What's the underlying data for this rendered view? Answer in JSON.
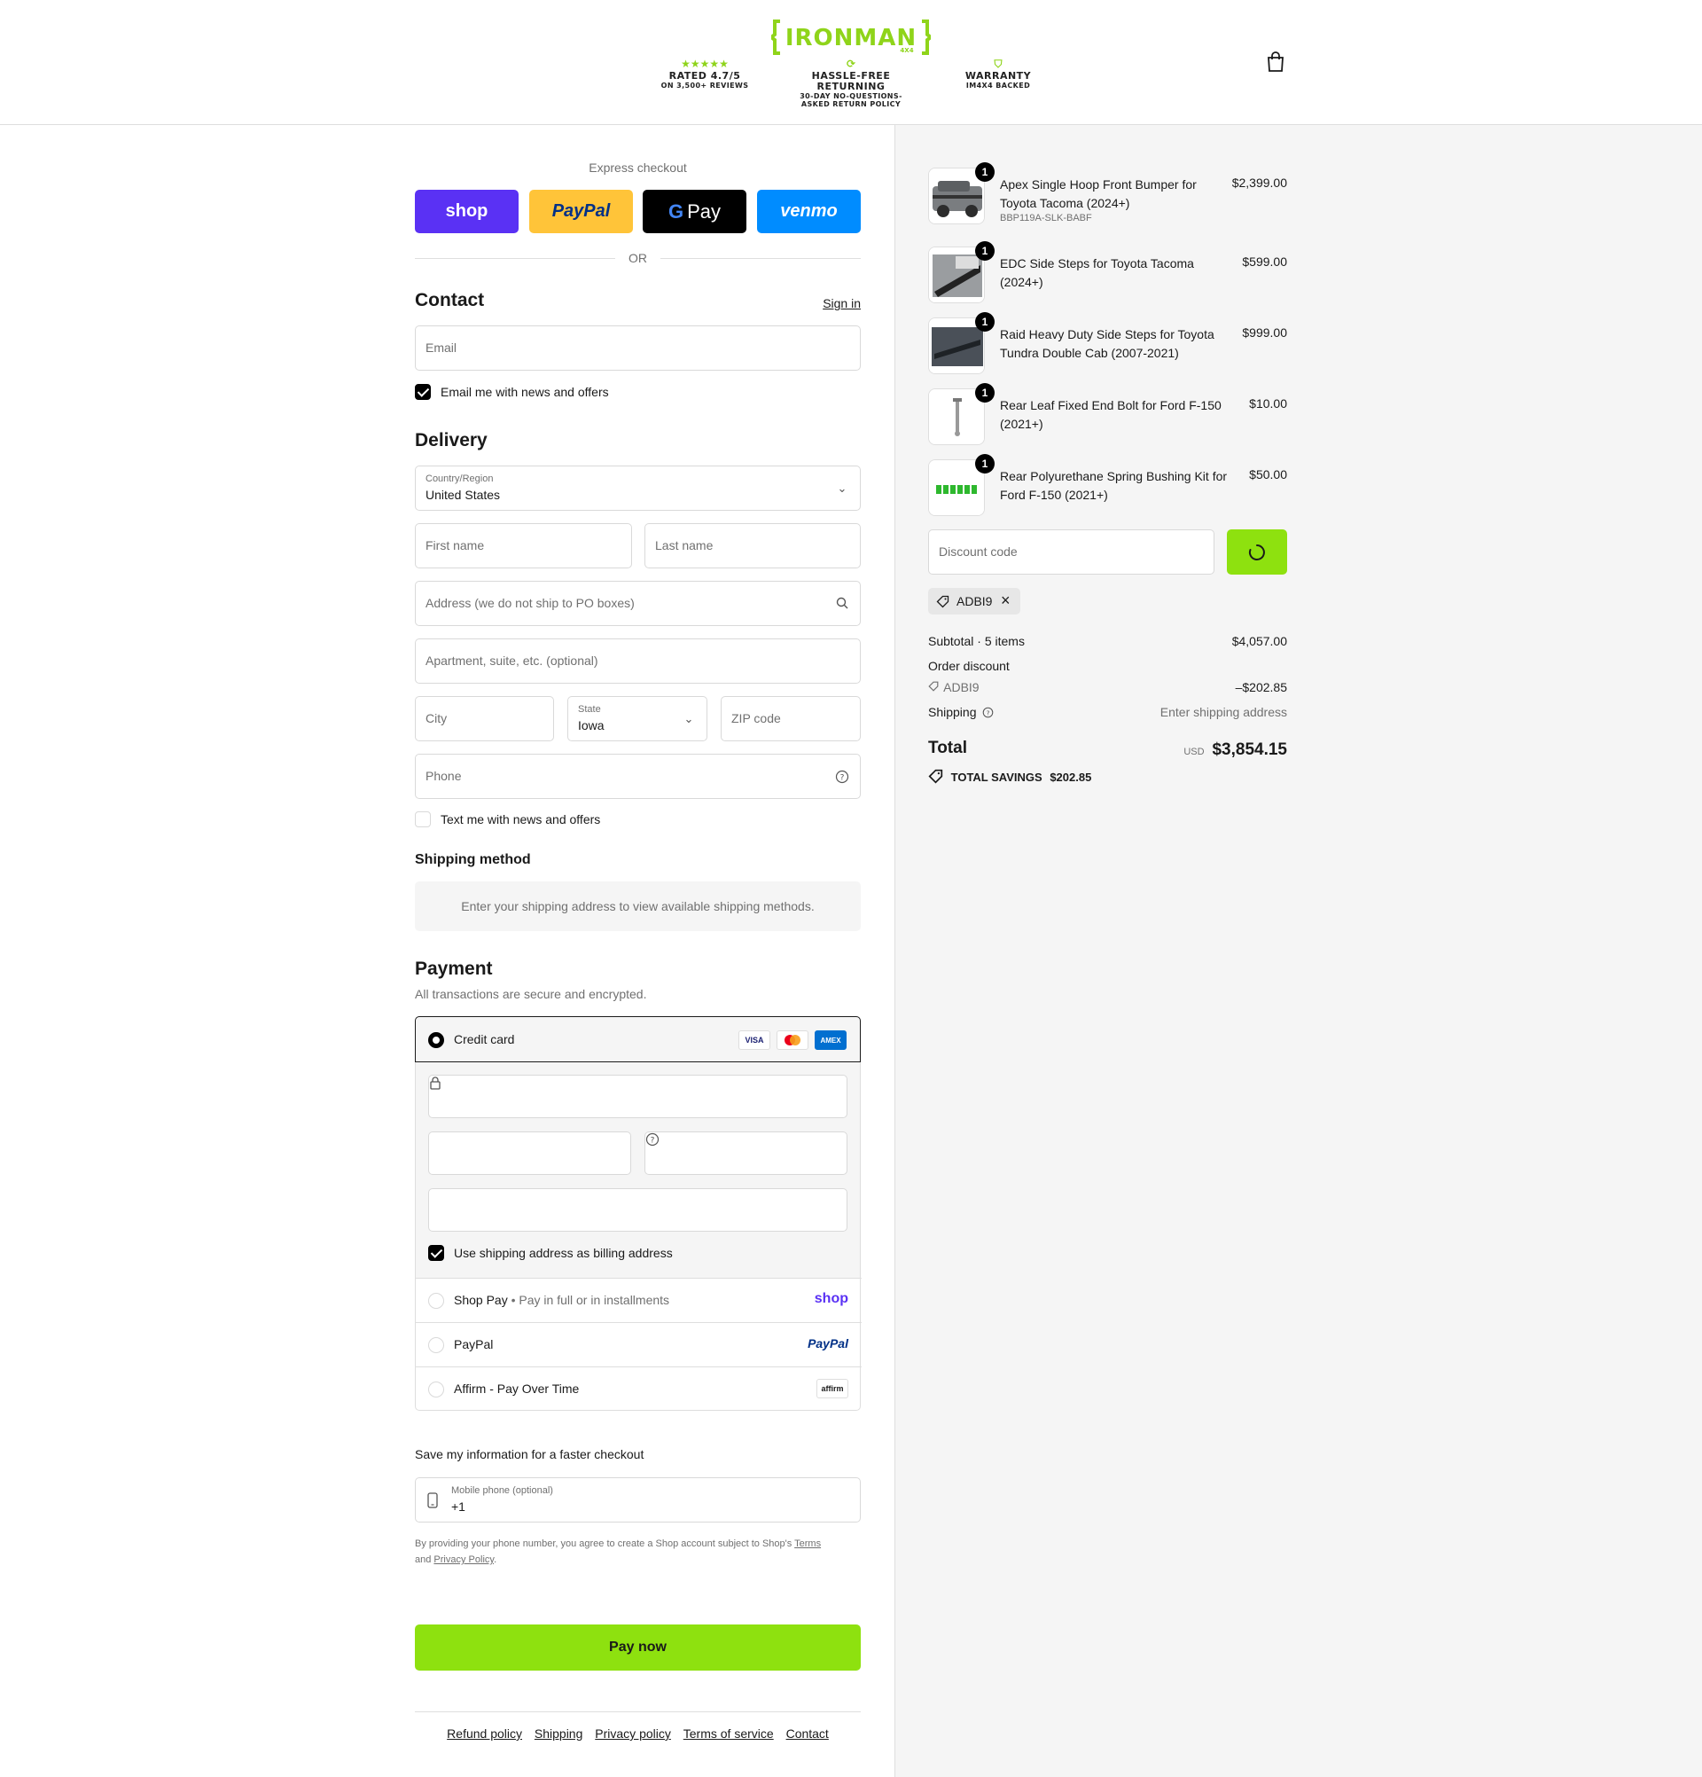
{
  "header": {
    "logo_text": "IRONMAN",
    "logo_sub": "4X4",
    "badges": [
      {
        "icon": "★★★★★",
        "line1": "RATED 4.7/5",
        "line2": "ON 3,500+ REVIEWS"
      },
      {
        "icon": "⟳",
        "line1": "HASSLE-FREE RETURNING",
        "line2": "30-DAY NO-QUESTIONS-ASKED RETURN POLICY"
      },
      {
        "icon": "⛉",
        "line1": "WARRANTY",
        "line2": "IM4X4 BACKED"
      }
    ],
    "cart_icon": "shopping-bag-icon"
  },
  "express": {
    "title": "Express checkout",
    "buttons": {
      "shop": "shop",
      "paypal": "PayPal",
      "gpay": "Pay",
      "venmo": "venmo"
    },
    "or": "OR"
  },
  "contact": {
    "title": "Contact",
    "sign_in": "Sign in",
    "email_placeholder": "Email",
    "email_news_label": "Email me with news and offers"
  },
  "delivery": {
    "title": "Delivery",
    "country_label": "Country/Region",
    "country_value": "United States",
    "first_name": "First name",
    "last_name": "Last name",
    "address": "Address (we do not ship to PO boxes)",
    "apartment": "Apartment, suite, etc. (optional)",
    "city": "City",
    "state_label": "State",
    "state_value": "Iowa",
    "zip": "ZIP code",
    "phone": "Phone",
    "text_news_label": "Text me with news and offers"
  },
  "shipping_method": {
    "title": "Shipping method",
    "info": "Enter your shipping address to view available shipping methods."
  },
  "payment": {
    "title": "Payment",
    "subtitle": "All transactions are secure and encrypted.",
    "credit_card_label": "Credit card",
    "card_brands": [
      "VISA",
      "Mastercard",
      "AMEX"
    ],
    "billing_same_label": "Use shipping address as billing address",
    "shop_pay_label": "Shop Pay",
    "shop_pay_sub": "Pay in full or in installments",
    "shop_pay_logo": "shop",
    "paypal_label": "PayPal",
    "paypal_logo": "PayPal",
    "affirm_label": "Affirm - Pay Over Time",
    "affirm_logo": "affirm"
  },
  "save_info": {
    "title": "Save my information for a faster checkout",
    "mobile_label": "Mobile phone (optional)",
    "mobile_value": "+1",
    "disclaimer_pre": "By providing your phone number, you agree to create a Shop account subject to Shop's",
    "terms": "Terms",
    "and": "and",
    "privacy": "Privacy Policy",
    "period": "."
  },
  "pay_now": "Pay now",
  "footer": {
    "links": [
      "Refund policy",
      "Shipping",
      "Privacy policy",
      "Terms of service",
      "Contact"
    ]
  },
  "order": {
    "items": [
      {
        "name": "Apex Single Hoop Front Bumper for Toyota Tacoma (2024+)",
        "sku": "BBP119A-SLK-BABF",
        "price": "$2,399.00",
        "qty": "1"
      },
      {
        "name": "EDC Side Steps for Toyota Tacoma (2024+)",
        "sku": "",
        "price": "$599.00",
        "qty": "1"
      },
      {
        "name": "Raid Heavy Duty Side Steps for Toyota Tundra Double Cab (2007-2021)",
        "sku": "",
        "price": "$999.00",
        "qty": "1"
      },
      {
        "name": "Rear Leaf Fixed End Bolt for Ford F-150 (2021+)",
        "sku": "",
        "price": "$10.00",
        "qty": "1"
      },
      {
        "name": "Rear Polyurethane Spring Bushing Kit for Ford F-150 (2021+)",
        "sku": "",
        "price": "$50.00",
        "qty": "1"
      }
    ],
    "discount_placeholder": "Discount code",
    "discount_tag": "ADBI9",
    "subtotal_label": "Subtotal · 5 items",
    "subtotal_value": "$4,057.00",
    "order_discount_label": "Order discount",
    "discount_code": "ADBI9",
    "discount_value": "–$202.85",
    "shipping_label": "Shipping",
    "shipping_value": "Enter shipping address",
    "total_label": "Total",
    "currency": "USD",
    "total_value": "$3,854.15",
    "savings_label": "TOTAL SAVINGS",
    "savings_value": "$202.85"
  },
  "colors": {
    "accent": "#8ee10f",
    "shop_purple": "#5a31f4",
    "paypal_yellow": "#ffc439",
    "venmo_blue": "#008cff"
  }
}
